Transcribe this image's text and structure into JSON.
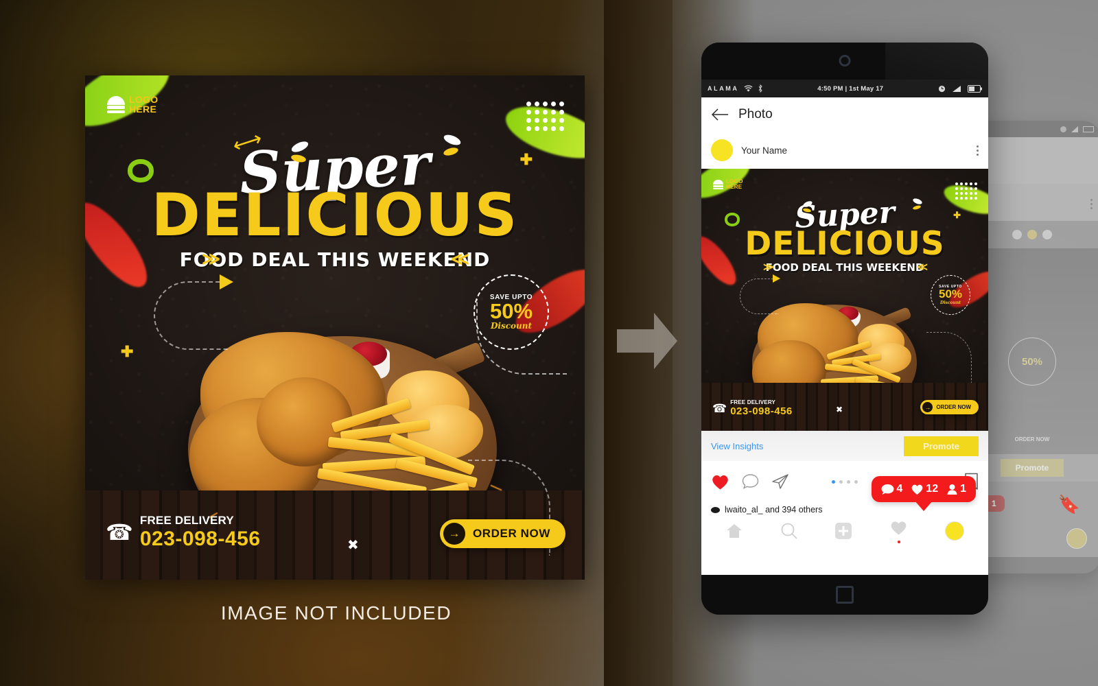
{
  "background": {
    "left_gradient": "#2a1f0c",
    "right_gray": "#909090"
  },
  "poster": {
    "logo": {
      "icon": "burger-icon",
      "line1": "LOGO",
      "line2": "HERE"
    },
    "dot_grid_icon": "dot-grid-icon",
    "headline_script": "Super",
    "headline_main": "DELICIOUS",
    "subheadline": "FOOD DEAL THIS WEEKEND",
    "discount_badge": {
      "line1": "SAVE UPTO",
      "line2": "50%",
      "line3": "Discount"
    },
    "delivery": {
      "icon": "phone-ringing-icon",
      "label": "FREE DELIVERY",
      "number": "023-098-456"
    },
    "cta": {
      "label": "ORDER NOW",
      "icon": "arrow-right-icon",
      "bg": "#F5CA1B"
    },
    "accent_yellow": "#F5CA1B",
    "caption_below": "IMAGE NOT INCLUDED"
  },
  "arrow": {
    "name": "transition-arrow",
    "direction": "right"
  },
  "phone": {
    "statusbar": {
      "carrier": "ALAMA",
      "wifi_icon": "wifi-icon",
      "bluetooth_icon": "bluetooth-icon",
      "time": "4:50 PM | 1st May 17",
      "alarm_icon": "alarm-clock-icon",
      "signal_icon": "signal-bars-icon",
      "battery_icon": "battery-icon"
    },
    "appbar": {
      "back_icon": "back-arrow-icon",
      "title": "Photo"
    },
    "user": {
      "avatar": "user-avatar",
      "name": "Your Name",
      "menu_icon": "kebab-menu-icon"
    },
    "insights": {
      "link": "View Insights",
      "promote_button": "Promote",
      "promote_bg": "#F1D81C"
    },
    "actions": {
      "like_icon": "heart-filled-icon",
      "comment_icon": "comment-bubble-icon",
      "share_icon": "send-paper-plane-icon",
      "save_icon": "bookmark-icon",
      "carousel_dots": 4,
      "carousel_active_index": 0
    },
    "notification": {
      "bg": "#f31b1b",
      "comments_icon": "comment-bubble-icon",
      "comments": "4",
      "likes_icon": "heart-filled-icon",
      "likes": "12",
      "followers_icon": "person-icon",
      "followers": "1"
    },
    "caption": {
      "liked_by": "lwaito_al_  and 394 others"
    },
    "navbar": {
      "home_icon": "home-icon",
      "search_icon": "search-icon",
      "add_icon": "add-plus-icon",
      "activity_icon": "heart-outline-icon",
      "profile_icon": "profile-avatar-icon"
    },
    "home_button_icon": "square-home-button-icon"
  },
  "ghost_phone": {
    "order_label": "ORDER NOW",
    "promote_label": "Promote",
    "badge_text": "50%",
    "follower_count": "1",
    "social_icons": [
      "facebook-icon",
      "instagram-icon",
      "whatsapp-icon"
    ]
  }
}
